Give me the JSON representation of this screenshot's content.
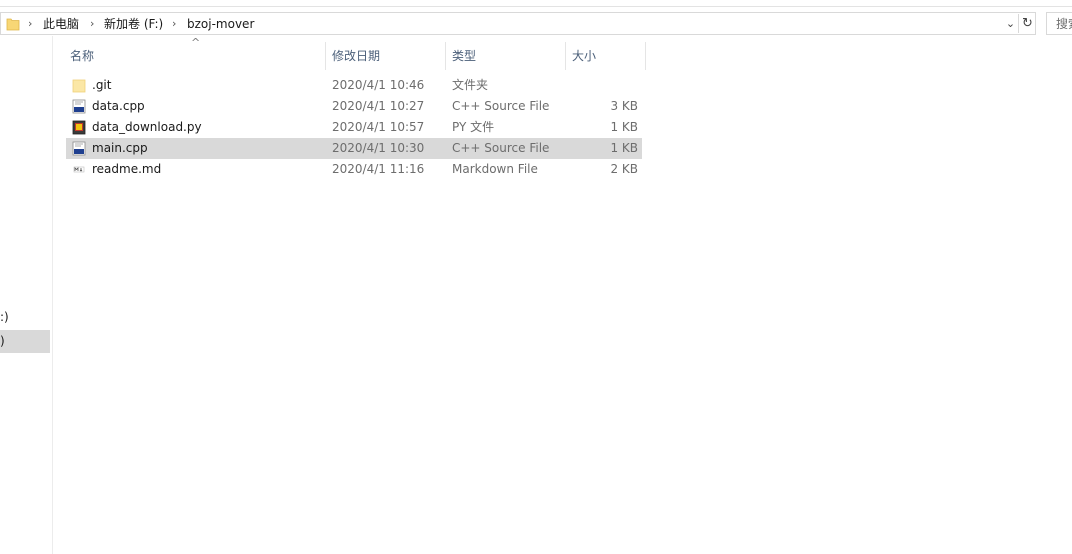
{
  "address": {
    "crumbs": [
      "此电脑",
      "新加卷 (F:)",
      "bzoj-mover"
    ],
    "separator": "›",
    "dropdown_glyph": "⌄",
    "refresh_glyph": "↻"
  },
  "search": {
    "placeholder": "搜索"
  },
  "nav_pane": {
    "items": [
      {
        "label": ":)",
        "selected": false
      },
      {
        "label": ")",
        "selected": true
      }
    ]
  },
  "columns": {
    "name": "名称",
    "date": "修改日期",
    "type": "类型",
    "size": "大小",
    "sort_indicator": "^"
  },
  "files": [
    {
      "name": ".git",
      "date": "2020/4/1 10:46",
      "type": "文件夹",
      "size": "",
      "icon": "folder-icon",
      "selected": false
    },
    {
      "name": "data.cpp",
      "date": "2020/4/1 10:27",
      "type": "C++ Source File",
      "size": "3 KB",
      "icon": "cpp-file-icon",
      "selected": false
    },
    {
      "name": "data_download.py",
      "date": "2020/4/1 10:57",
      "type": "PY 文件",
      "size": "1 KB",
      "icon": "python-file-icon",
      "selected": false
    },
    {
      "name": "main.cpp",
      "date": "2020/4/1 10:30",
      "type": "C++ Source File",
      "size": "1 KB",
      "icon": "cpp-file-icon",
      "selected": true
    },
    {
      "name": "readme.md",
      "date": "2020/4/1 11:16",
      "type": "Markdown File",
      "size": "2 KB",
      "icon": "markdown-file-icon",
      "selected": false
    }
  ],
  "colors": {
    "selection": "#d9d9d9",
    "header_text": "#4c607a",
    "folder": "#f8d775"
  }
}
